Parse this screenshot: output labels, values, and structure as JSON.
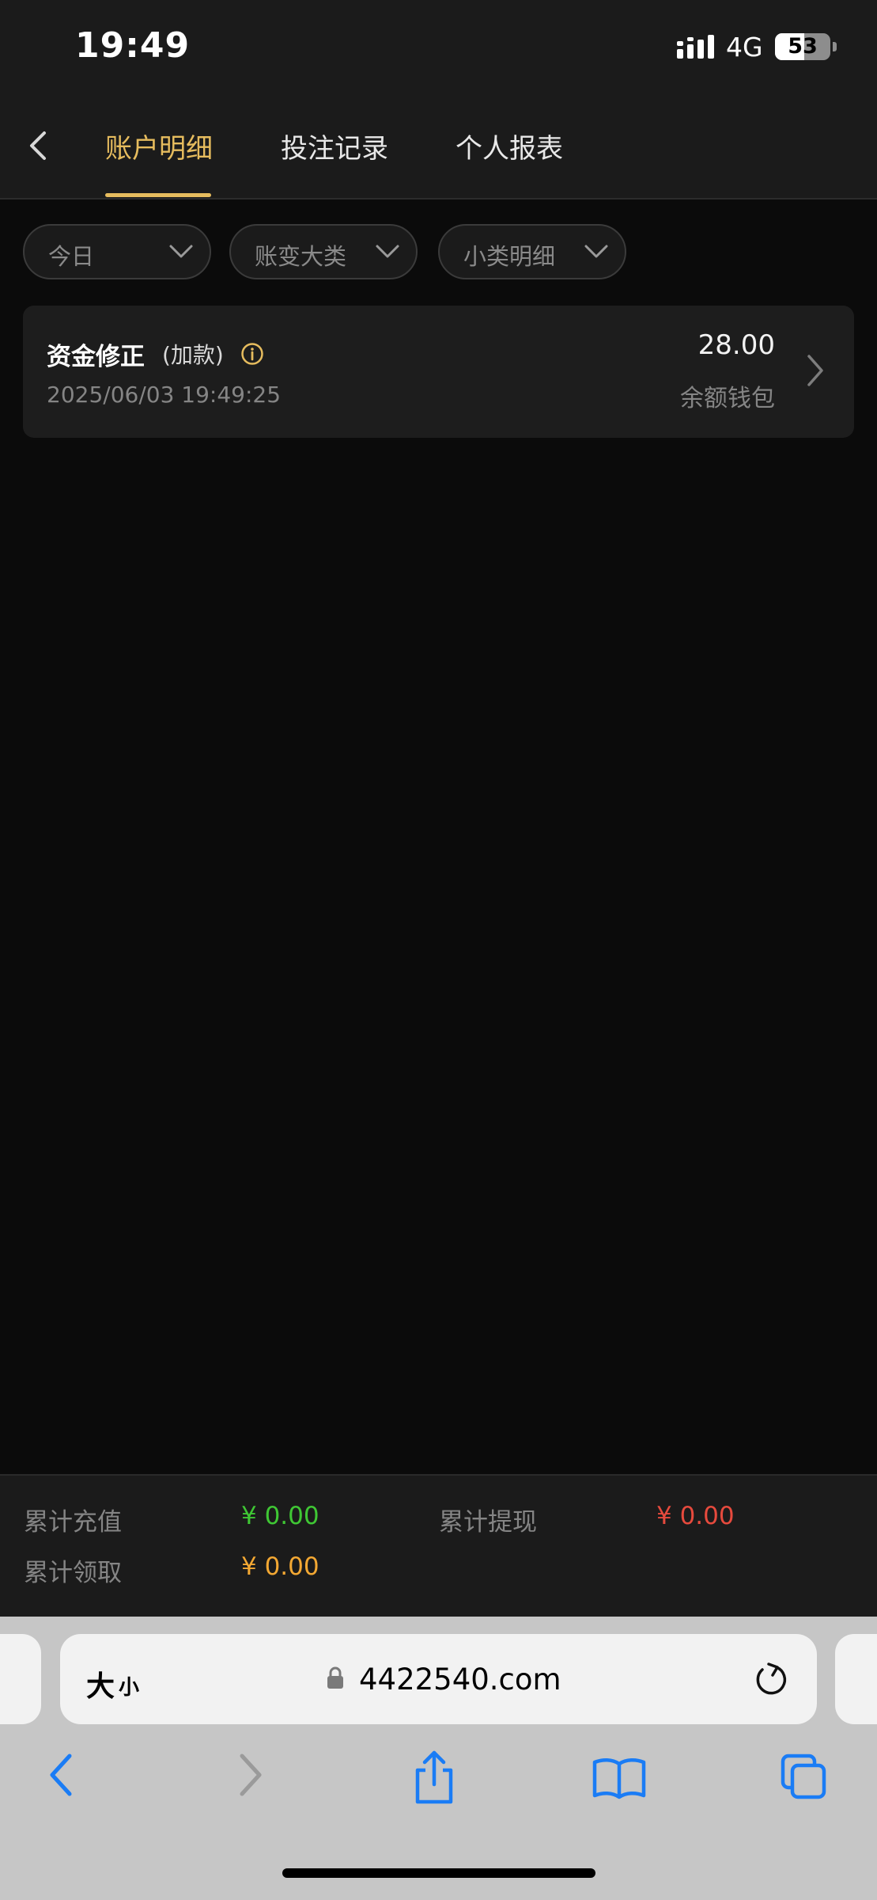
{
  "status_bar": {
    "time": "19:49",
    "network": "4G",
    "battery": "53",
    "battery_level": 0.53
  },
  "header": {
    "tabs": [
      {
        "label": "账户明细",
        "active": true
      },
      {
        "label": "投注记录",
        "active": false
      },
      {
        "label": "个人报表",
        "active": false
      }
    ],
    "back_icon": "chevron-left-icon"
  },
  "filters": [
    {
      "label": "今日"
    },
    {
      "label": "账变大类"
    },
    {
      "label": "小类明细"
    }
  ],
  "records": [
    {
      "title": "资金修正",
      "subtitle": "(加款)",
      "time": "2025/06/03 19:49:25",
      "amount": "28.00",
      "wallet": "余额钱包"
    }
  ],
  "summary": {
    "recharge_label": "累计充值",
    "recharge_value": "¥ 0.00",
    "withdraw_label": "累计提现",
    "withdraw_value": "¥ 0.00",
    "claim_label": "累计领取",
    "claim_value": "¥ 0.00"
  },
  "browser": {
    "text_size_big": "大",
    "text_size_small": "小",
    "domain": "4422540.com"
  },
  "colors": {
    "accent": "#e6bc5e",
    "recharge": "#3fc734",
    "withdraw": "#e64a3d",
    "claim": "#f3a833",
    "ios_blue": "#1a7cf5"
  }
}
